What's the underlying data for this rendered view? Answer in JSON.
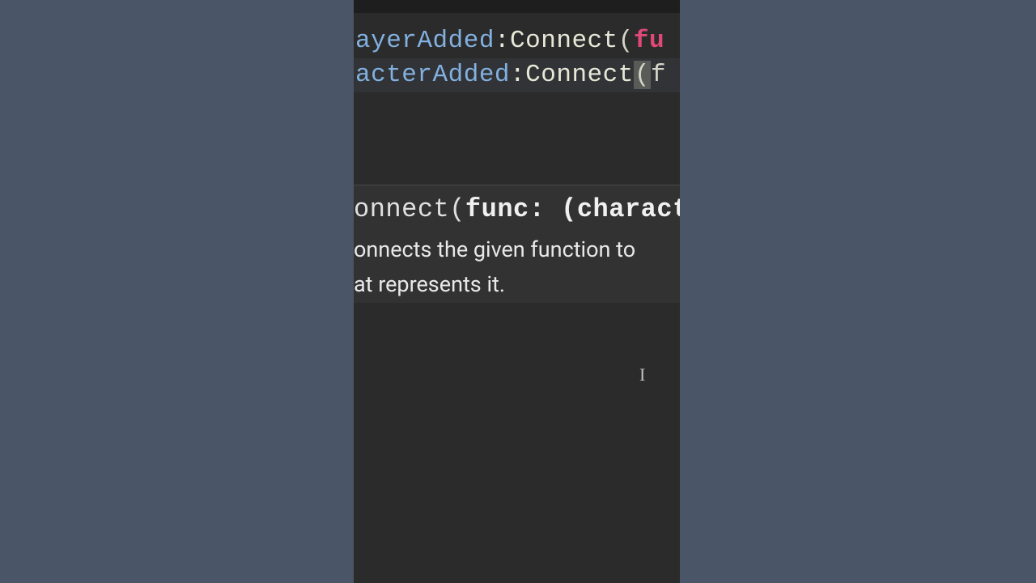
{
  "code": {
    "line1": {
      "event_fragment": "ayerAdded",
      "colon": ":",
      "method": "Connect",
      "paren_open": "(",
      "keyword_fragment": "fu"
    },
    "line2": {
      "event_fragment": "acterAdded",
      "colon": ":",
      "method": "Connect",
      "paren_open": "(",
      "plain_fragment": "f"
    }
  },
  "tooltip": {
    "signature": {
      "prefix_fragment": "onnect(",
      "param_name_bold": "func: (charact"
    },
    "description_line1_fragment": "onnects the given function to",
    "description_line2_fragment": "at represents it."
  },
  "cursor": {
    "glyph": "I"
  },
  "colors": {
    "background_sides": "#4a5568",
    "editor_bg": "#2b2b2b",
    "tooltip_bg": "#323232",
    "event_color": "#82b0e0",
    "method_color": "#e8e8d8",
    "keyword_color": "#e04878"
  }
}
